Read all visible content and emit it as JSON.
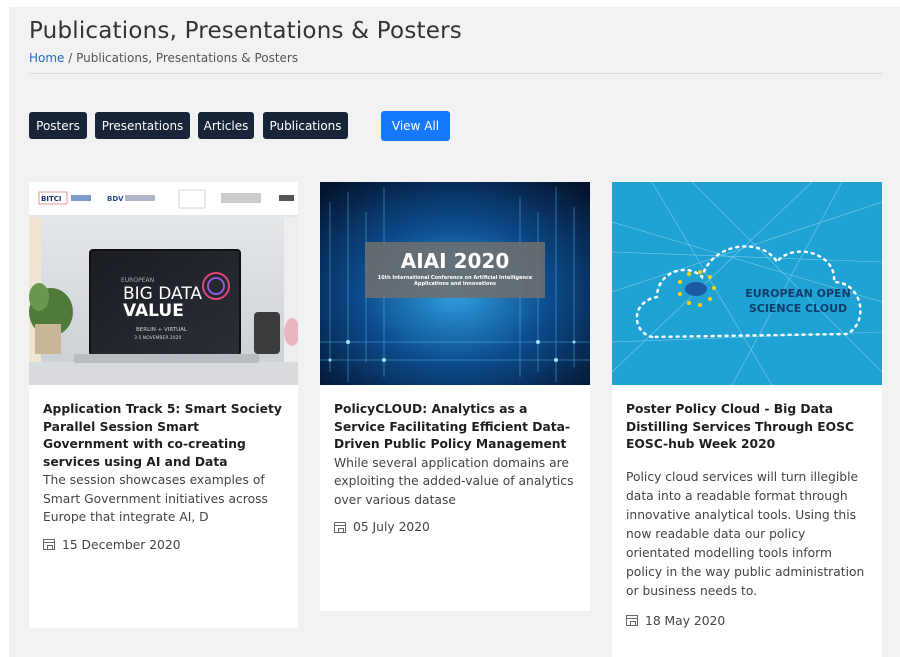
{
  "page": {
    "title": "Publications, Presentations & Posters",
    "breadcrumb": {
      "home": "Home",
      "separator": " / ",
      "current": "Publications, Presentations & Posters"
    }
  },
  "filters": {
    "posters": "Posters",
    "presentations": "Presentations",
    "articles": "Articles",
    "publications": "Publications",
    "view_all": "View All"
  },
  "cards": [
    {
      "title": "Application Track 5: Smart Society Parallel Session Smart Government with co-creating services using AI and Data",
      "excerpt": "The session showcases examples of Smart Government initiatives across Europe that integrate AI, D",
      "date": "15 December 2020",
      "thumb": {
        "screen_line1": "BIG DATA",
        "screen_line2": "VALUE",
        "screen_sub": "BERLIN + VIRTUAL",
        "screen_sub2": "3-5 NOVEMBER 2020",
        "logo1": "BITCI",
        "logo2": "BDV"
      }
    },
    {
      "title": "PolicyCLOUD: Analytics as a Service Facilitating Efficient Data-Driven Public Policy Management",
      "excerpt": "While several application domains are exploiting the added-value of analytics over various datase",
      "date": "05 July 2020",
      "thumb": {
        "headline": "AIAI 2020",
        "subline": "16th International Conference on Artificial Intelligence Applications and Innovations"
      }
    },
    {
      "title": "Poster Policy Cloud - Big Data Distilling Services Through EOSC EOSC-hub Week 2020",
      "excerpt": "Policy cloud services will turn illegible data into a readable format through innovative analytical tools. Using this now readable data our policy orientated modelling tools inform policy in the way public administration or business needs to.",
      "date": "18 May 2020",
      "thumb": {
        "line1": "EUROPEAN OPEN",
        "line2": "SCIENCE CLOUD"
      }
    }
  ],
  "colors": {
    "filter_bg": "#182538",
    "view_all_bg": "#1677ff",
    "link": "#1a6fd6"
  }
}
